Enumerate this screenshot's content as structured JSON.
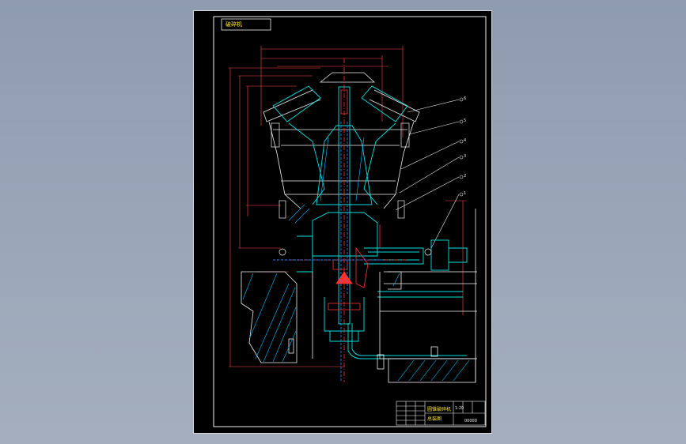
{
  "drawing": {
    "title_tag": "破碎机",
    "title_block": {
      "name": "圆锥破碎机",
      "model": "总装图",
      "code": "00000",
      "scale": "1:20"
    },
    "balloons": [
      "6",
      "5",
      "4",
      "3",
      "2",
      "1"
    ]
  },
  "colors": {
    "background": "#000000",
    "outline": "#ffffff",
    "center_line": "#ff3030",
    "section": "#00e0e0",
    "dimension": "#ff5050",
    "hatch": "#00a0ff",
    "label": "#ffe63a"
  }
}
